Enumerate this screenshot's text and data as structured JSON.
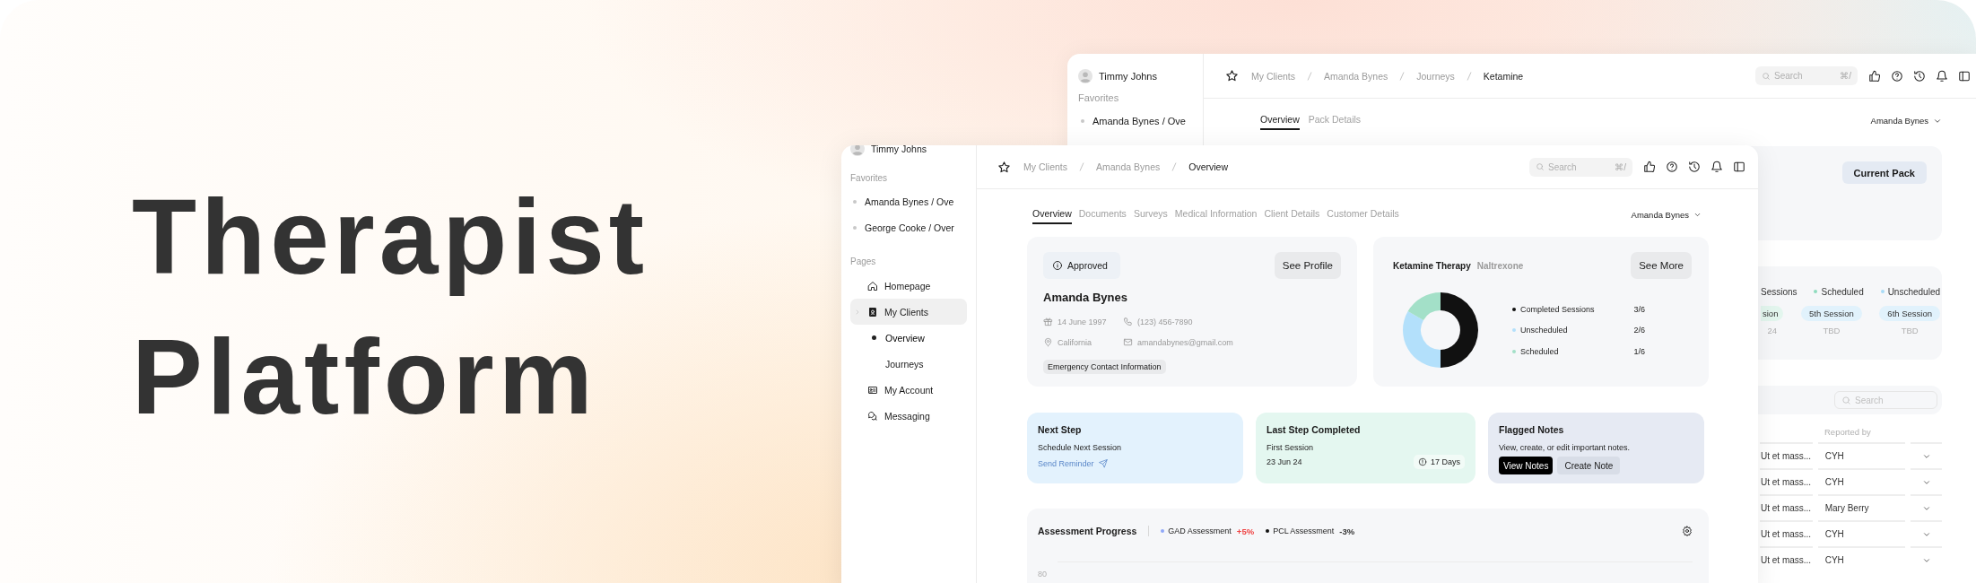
{
  "banner": {
    "title": "Therapist Platform"
  },
  "back_window": {
    "user": "Timmy Johns",
    "favorites_heading": "Favorites",
    "favorites": [
      {
        "label": "Amanda Bynes / Ove"
      }
    ],
    "breadcrumb": [
      {
        "label": "My Clients",
        "current": false
      },
      {
        "label": "Amanda Bynes",
        "current": false
      },
      {
        "label": "Journeys",
        "current": false
      },
      {
        "label": "Ketamine",
        "current": true
      }
    ],
    "search": {
      "placeholder": "Search",
      "shortcut": "⌘/"
    },
    "tabs": [
      {
        "label": "Overview",
        "selected": true
      },
      {
        "label": "Pack Details",
        "selected": false
      }
    ],
    "client_select": "Amanda Bynes",
    "pack_button": "Current Pack",
    "session_legend": [
      {
        "label": "Sessions"
      },
      {
        "label": "Scheduled",
        "color": "#8fdcbf"
      },
      {
        "label": "Unscheduled",
        "color": "#a9dcf7"
      }
    ],
    "sessions": [
      {
        "label": "sion",
        "date": "24",
        "color": "#e3f6ee"
      },
      {
        "label": "5th Session",
        "date": "TBD",
        "color": "#e1f2fc"
      },
      {
        "label": "6th Session",
        "date": "TBD",
        "color": "#e1f2fc"
      }
    ],
    "table_search": {
      "placeholder": "Search"
    },
    "table": {
      "reported_by_heading": "Reported by",
      "rows": [
        {
          "note": "Ut et mass...",
          "reported_by": "CYH"
        },
        {
          "note": "Ut et mass...",
          "reported_by": "CYH"
        },
        {
          "note": "Ut et mass...",
          "reported_by": "Mary Berry"
        },
        {
          "note": "Ut et mass...",
          "reported_by": "CYH"
        },
        {
          "note": "Ut et mass...",
          "reported_by": "CYH"
        }
      ]
    }
  },
  "front_window": {
    "user": "Timmy Johns",
    "favorites_heading": "Favorites",
    "favorites": [
      {
        "label": "Amanda Bynes / Ove"
      },
      {
        "label": "George Cooke / Over"
      }
    ],
    "pages_heading": "Pages",
    "pages": [
      {
        "label": "Homepage",
        "selected": false
      },
      {
        "label": "My Clients",
        "selected": true,
        "children": [
          {
            "label": "Overview",
            "selected": true
          },
          {
            "label": "Journeys",
            "selected": false
          }
        ]
      },
      {
        "label": "My Account",
        "selected": false
      },
      {
        "label": "Messaging",
        "selected": false
      }
    ],
    "breadcrumb": [
      {
        "label": "My Clients",
        "current": false
      },
      {
        "label": "Amanda Bynes",
        "current": false
      },
      {
        "label": "Overview",
        "current": true
      }
    ],
    "search": {
      "placeholder": "Search",
      "shortcut": "⌘/"
    },
    "tabs": [
      {
        "label": "Overview",
        "selected": true
      },
      {
        "label": "Documents",
        "selected": false
      },
      {
        "label": "Surveys",
        "selected": false
      },
      {
        "label": "Medical Information",
        "selected": false
      },
      {
        "label": "Client Details",
        "selected": false
      },
      {
        "label": "Customer Details",
        "selected": false
      }
    ],
    "client_select": "Amanda Bynes",
    "profile": {
      "status": "Approved",
      "button": "See Profile",
      "name": "Amanda Bynes",
      "details": [
        "14 June 1997",
        "(123) 456-7890",
        "California",
        "amandabynes@gmail.com"
      ],
      "emergency": "Emergency Contact Information"
    },
    "therapy": {
      "title": "Ketamine Therapy",
      "subtitle": "Naltrexone",
      "button": "See More",
      "legend": [
        {
          "value": "3/6",
          "color": "#111111"
        },
        {
          "value": "2/6",
          "color": "#b3e0fb"
        },
        {
          "value": "1/6",
          "color": "#a3e0c8"
        }
      ],
      "chart_data": {
        "type": "donut",
        "categories": [
          "Completed Sessions",
          "Unscheduled",
          "Scheduled"
        ],
        "values": [
          50,
          33.33,
          16.67
        ]
      }
    },
    "next_step": {
      "title": "Next Step",
      "text": "Schedule Next Session",
      "link": "Send Reminder"
    },
    "last_step": {
      "title": "Last Step Completed",
      "text": "First Session",
      "date": "23 Jun 24",
      "badge": "17 Days"
    },
    "flagged": {
      "title": "Flagged Notes",
      "text": "View, create, or edit important notes.",
      "primary_button": "View Notes",
      "secondary_button": "Create Note"
    },
    "assessment": {
      "title": "Assessment Progress",
      "legend": [
        {
          "label": "GAD Assessment",
          "change": {
            "text": "+5%",
            "color": "#ef4444"
          },
          "color": "#8fa8f8"
        },
        {
          "label": "PCL Assessment",
          "change": {
            "text": "-3%",
            "color": "#333333"
          },
          "color": "#111111"
        }
      ],
      "y_tick": "80"
    }
  }
}
